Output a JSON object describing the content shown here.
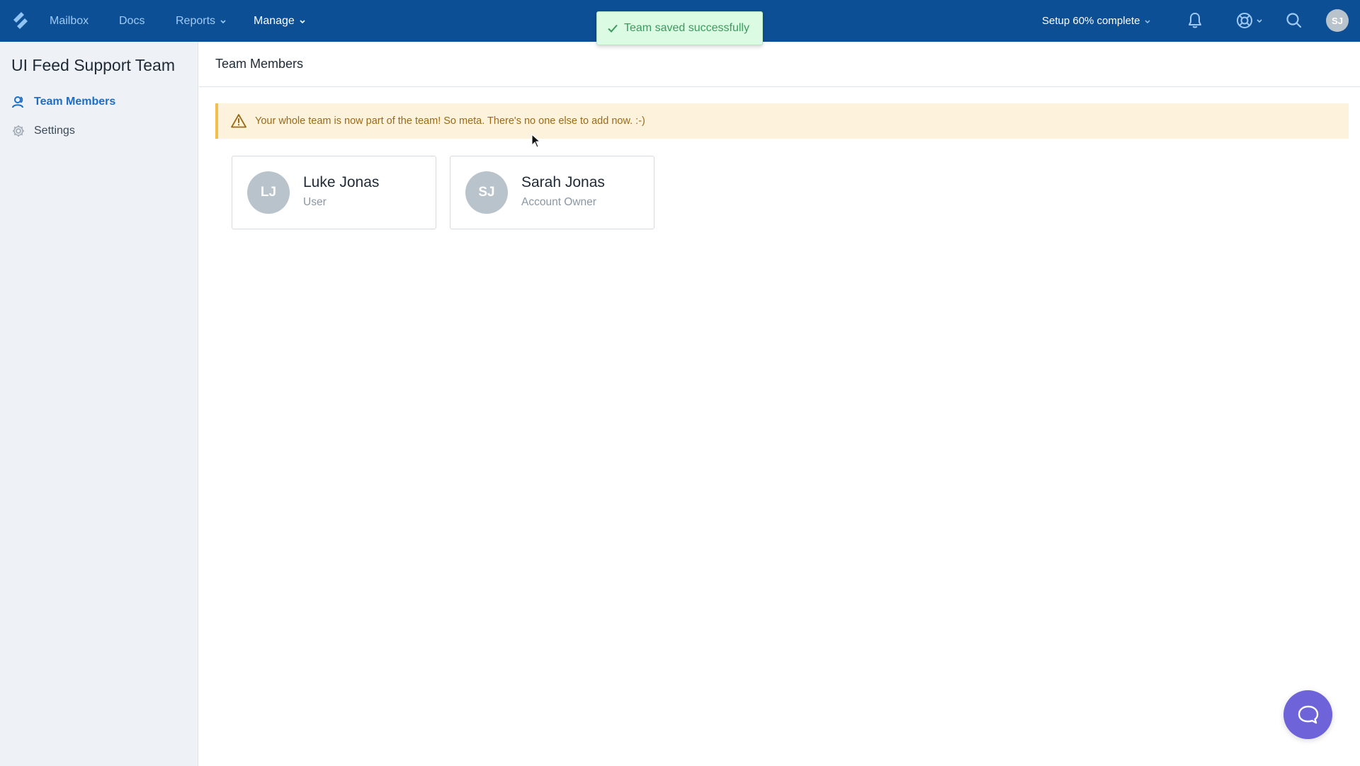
{
  "topnav": {
    "logo_icon": "helpscout-logo-icon",
    "links": [
      {
        "label": "Mailbox",
        "has_dropdown": false,
        "active": false
      },
      {
        "label": "Docs",
        "has_dropdown": false,
        "active": false
      },
      {
        "label": "Reports",
        "has_dropdown": true,
        "active": false
      },
      {
        "label": "Manage",
        "has_dropdown": true,
        "active": true
      }
    ],
    "setup_label": "Setup 60% complete",
    "setup_progress_percent": 60,
    "icons": [
      "bell-icon",
      "help-lifebuoy-icon",
      "search-icon"
    ],
    "user_initials": "SJ"
  },
  "toast": {
    "icon": "check-icon",
    "message": "Team saved successfully"
  },
  "sidebar": {
    "title": "UI Feed Support Team",
    "items": [
      {
        "label": "Team Members",
        "icon": "users-icon",
        "active": true
      },
      {
        "label": "Settings",
        "icon": "gear-icon",
        "active": false
      }
    ]
  },
  "main": {
    "title": "Team Members",
    "alert": {
      "icon": "warning-icon",
      "message": "Your whole team is now part of the team! So meta. There's no one else to add now. :-)"
    },
    "members": [
      {
        "initials": "LJ",
        "name": "Luke Jonas",
        "role": "User"
      },
      {
        "initials": "SJ",
        "name": "Sarah Jonas",
        "role": "Account Owner"
      }
    ]
  },
  "beacon": {
    "icon": "chat-bubble-icon"
  },
  "colors": {
    "nav_bg": "#0c4f94",
    "nav_link": "#9fcaf6",
    "accent": "#1d6ec4",
    "toast_bg": "#dcfbe3",
    "toast_text": "#3c9a5f",
    "alert_bg": "#fdf3dd",
    "alert_border": "#f2bf4a",
    "beacon": "#6e63d9"
  }
}
